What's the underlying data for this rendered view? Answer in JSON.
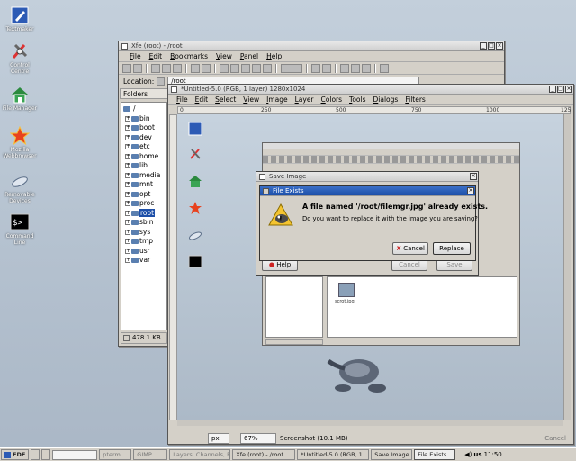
{
  "desktop": {
    "icons": [
      {
        "label": "Textmaker",
        "icon": "textmaker-icon"
      },
      {
        "label": "Control Centre",
        "icon": "control-centre-icon"
      },
      {
        "label": "File Manager",
        "icon": "file-manager-icon"
      },
      {
        "label": "Mozilla Webbrowser",
        "icon": "mozilla-icon"
      },
      {
        "label": "Removable Devices",
        "icon": "removable-devices-icon"
      },
      {
        "label": "Command Line",
        "icon": "terminal-icon"
      }
    ]
  },
  "xfe": {
    "title": "Xfe (root) - /root",
    "menu": [
      "File",
      "Edit",
      "Bookmarks",
      "View",
      "Panel",
      "Help"
    ],
    "location_label": "Location:",
    "location_value": "/root",
    "folders_header": "Folders",
    "tree": [
      "/",
      "bin",
      "boot",
      "dev",
      "etc",
      "home",
      "lib",
      "media",
      "mnt",
      "opt",
      "proc",
      "root",
      "sbin",
      "sys",
      "tmp",
      "usr",
      "var"
    ],
    "selected": "root",
    "status": "478.1 KB"
  },
  "gimp": {
    "title": "*Untitled-5.0 (RGB, 1 layer) 1280x1024",
    "menu": [
      "File",
      "Edit",
      "Select",
      "View",
      "Image",
      "Layer",
      "Colors",
      "Tools",
      "Dialogs",
      "Filters"
    ],
    "ruler_ticks": [
      "0",
      "250",
      "500",
      "750",
      "1000",
      "125"
    ],
    "unit": "px",
    "zoom": "67%",
    "status": "Screenshot (10.1 MB)",
    "cancel": "Cancel"
  },
  "save_image": {
    "title": "Save Image",
    "help": "Help",
    "cancel": "Cancel",
    "save": "Save",
    "file_thumb_label": "scrot.jpg"
  },
  "file_exists": {
    "title": "File Exists",
    "headline": "A file named '/root/filemgr.jpg' already exists.",
    "message": "Do you want to replace it with the image you are saving?",
    "cancel_label": "Cancel",
    "replace_label": "Replace"
  },
  "taskbar": {
    "start": "EDE",
    "items": [
      "pterm",
      "GIMP",
      "Layers, Channels, P...",
      "Xfe (root) - /root",
      "*Untitled-5.0 (RGB, 1...",
      "Save Image",
      "File Exists"
    ],
    "locale": "us",
    "clock": "11:50"
  }
}
